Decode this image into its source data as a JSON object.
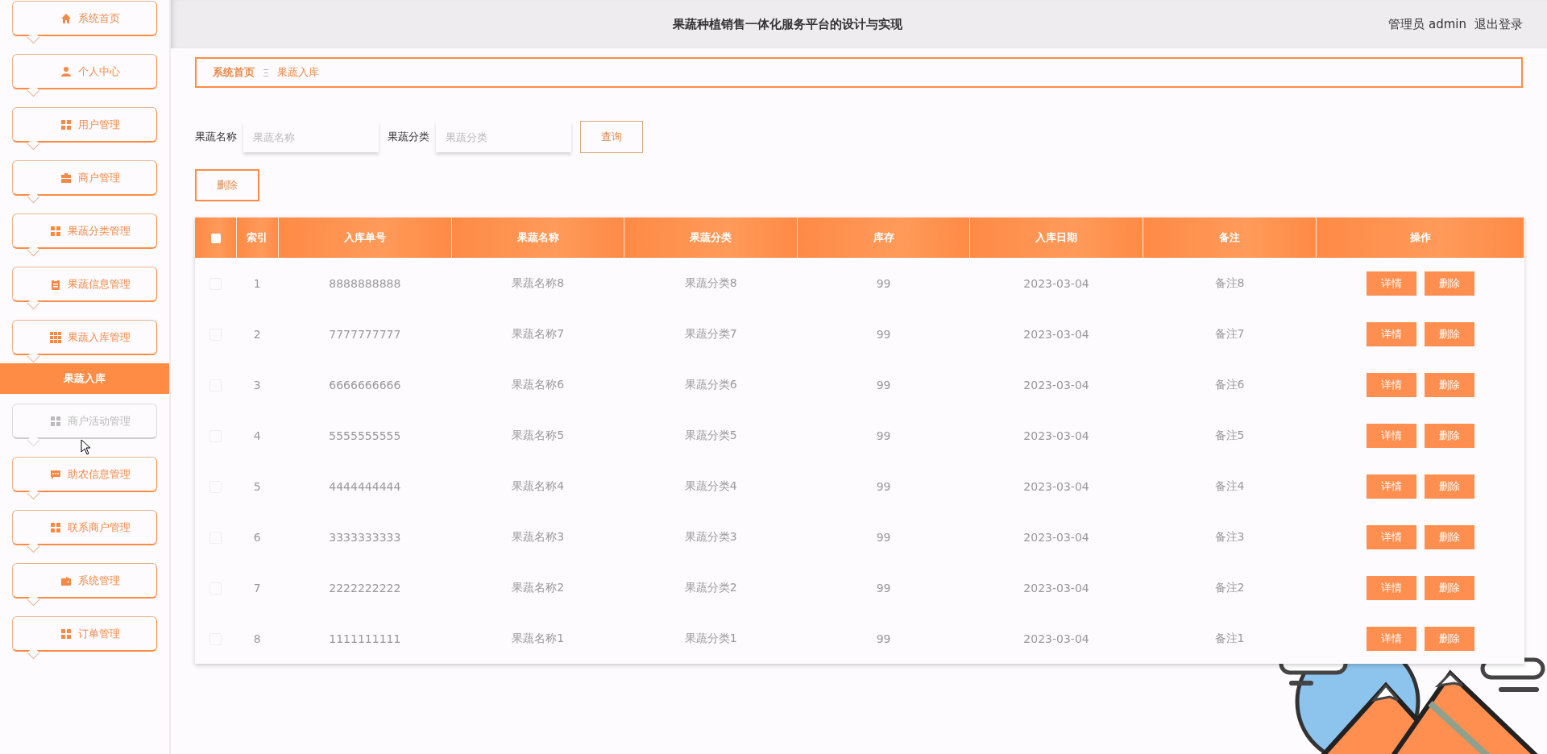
{
  "sidebar": {
    "items": [
      {
        "label": "系统首页",
        "hovered": false
      },
      {
        "label": "个人中心",
        "hovered": false
      },
      {
        "label": "用户管理",
        "hovered": false
      },
      {
        "label": "商户管理",
        "hovered": false
      },
      {
        "label": "果蔬分类管理",
        "hovered": false
      },
      {
        "label": "果蔬信息管理",
        "hovered": false
      },
      {
        "label": "果蔬入库管理",
        "hovered": false,
        "children": [
          {
            "label": "果蔬入库",
            "selected": true
          }
        ]
      },
      {
        "label": "商户活动管理",
        "hovered": true
      },
      {
        "label": "助农信息管理",
        "hovered": false
      },
      {
        "label": "联系商户管理",
        "hovered": false
      },
      {
        "label": "系统管理",
        "hovered": false
      },
      {
        "label": "订单管理",
        "hovered": false
      }
    ]
  },
  "header": {
    "title": "果蔬种植销售一体化服务平台的设计与实现",
    "user": "管理员 admin",
    "logout": "退出登录"
  },
  "breadcrumb": {
    "items": [
      "系统首页",
      "果蔬入库"
    ],
    "separator": "Ξ"
  },
  "search": {
    "fields": [
      {
        "label": "果蔬名称",
        "placeholder": "果蔬名称"
      },
      {
        "label": "果蔬分类",
        "placeholder": "果蔬分类"
      }
    ],
    "button": "查询"
  },
  "toolbar": {
    "delete_button": "删除"
  },
  "table": {
    "header_checkbox": {
      "checked": false
    },
    "columns": [
      "索引",
      "入库单号",
      "果蔬名称",
      "果蔬分类",
      "库存",
      "入库日期",
      "备注",
      "操作"
    ],
    "rows": [
      {
        "checked": false,
        "cells": [
          "1",
          "8888888888",
          "果蔬名称8",
          "果蔬分类8",
          "99",
          "2023-03-04",
          "备注8"
        ],
        "actions": [
          "详情",
          "删除"
        ]
      },
      {
        "checked": false,
        "cells": [
          "2",
          "7777777777",
          "果蔬名称7",
          "果蔬分类7",
          "99",
          "2023-03-04",
          "备注7"
        ],
        "actions": [
          "详情",
          "删除"
        ]
      },
      {
        "checked": false,
        "cells": [
          "3",
          "6666666666",
          "果蔬名称6",
          "果蔬分类6",
          "99",
          "2023-03-04",
          "备注6"
        ],
        "actions": [
          "详情",
          "删除"
        ]
      },
      {
        "checked": false,
        "cells": [
          "4",
          "5555555555",
          "果蔬名称5",
          "果蔬分类5",
          "99",
          "2023-03-04",
          "备注5"
        ],
        "actions": [
          "详情",
          "删除"
        ]
      },
      {
        "checked": false,
        "cells": [
          "5",
          "4444444444",
          "果蔬名称4",
          "果蔬分类4",
          "99",
          "2023-03-04",
          "备注4"
        ],
        "actions": [
          "详情",
          "删除"
        ]
      },
      {
        "checked": false,
        "cells": [
          "6",
          "3333333333",
          "果蔬名称3",
          "果蔬分类3",
          "99",
          "2023-03-04",
          "备注3"
        ],
        "actions": [
          "详情",
          "删除"
        ]
      },
      {
        "checked": false,
        "cells": [
          "7",
          "2222222222",
          "果蔬名称2",
          "果蔬分类2",
          "99",
          "2023-03-04",
          "备注2"
        ],
        "actions": [
          "详情",
          "删除"
        ]
      },
      {
        "checked": false,
        "cells": [
          "8",
          "1111111111",
          "果蔬名称1",
          "果蔬分类1",
          "99",
          "2023-03-04",
          "备注1"
        ],
        "actions": [
          "详情",
          "删除"
        ]
      }
    ]
  }
}
